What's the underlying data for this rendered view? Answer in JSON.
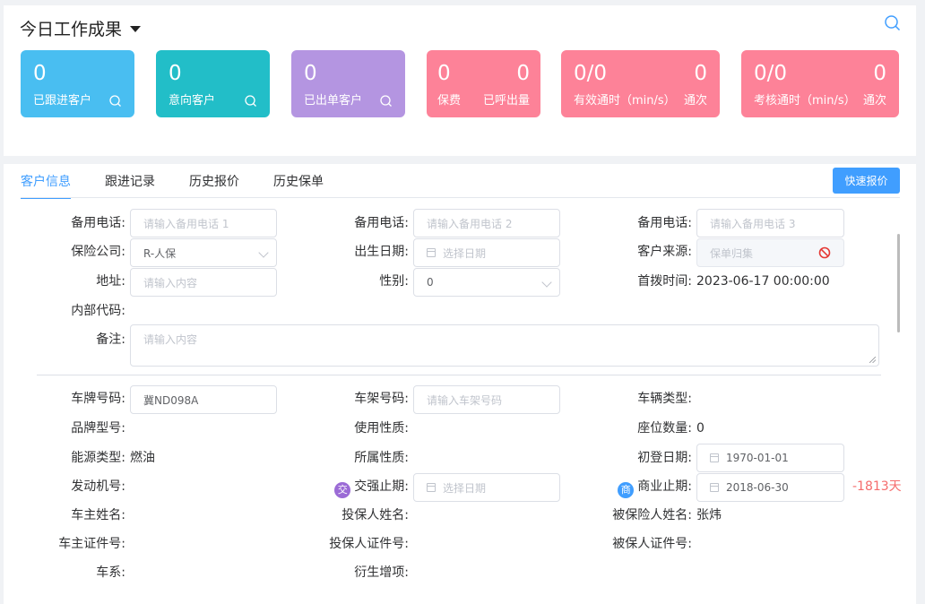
{
  "header": {
    "title": "今日工作成果"
  },
  "colors": {
    "blue": "#49bef1",
    "teal": "#22bec8",
    "purple": "#b495e1",
    "pink": "#fd8298",
    "primary": "#409eff",
    "danger": "#f56c6c"
  },
  "cards": {
    "followed": {
      "value": "0",
      "label": "已跟进客户"
    },
    "intent": {
      "value": "0",
      "label": "意向客户"
    },
    "issued": {
      "value": "0",
      "label": "已出单客户"
    },
    "premium": {
      "value": "0",
      "label": "保费",
      "value2": "0",
      "label2": "已呼出量"
    },
    "effective": {
      "value": "0/0",
      "label": "有效通时（min/s）",
      "value2": "0",
      "label2": "通次"
    },
    "assess": {
      "value": "0/0",
      "label": "考核通时（min/s）",
      "value2": "0",
      "label2": "通次"
    }
  },
  "tabs": [
    "客户信息",
    "跟进记录",
    "历史报价",
    "历史保单"
  ],
  "quick_quote_label": "快速报价",
  "form": {
    "backup_phone_label": "备用电话:",
    "backup_phone1_placeholder": "请输入备用电话 1",
    "backup_phone2_placeholder": "请输入备用电话 2",
    "backup_phone3_placeholder": "请输入备用电话 3",
    "insurer_label": "保险公司:",
    "insurer_value": "R-人保",
    "birth_label": "出生日期:",
    "birth_placeholder": "选择日期",
    "source_label": "客户来源:",
    "source_value": "保单归集",
    "address_label": "地址:",
    "address_placeholder": "请输入内容",
    "gender_label": "性别:",
    "gender_value": "0",
    "first_dial_label": "首拨时间:",
    "first_dial_value": "2023-06-17 00:00:00",
    "internal_code_label": "内部代码:",
    "remark_label": "备注:",
    "remark_placeholder": "请输入内容"
  },
  "vehicle": {
    "plate_label": "车牌号码:",
    "plate_value": "冀ND098A",
    "vin_label": "车架号码:",
    "vin_placeholder": "请输入车架号码",
    "vehicle_type_label": "车辆类型:",
    "brand_label": "品牌型号:",
    "usage_label": "使用性质:",
    "seats_label": "座位数量:",
    "seats_value": "0",
    "energy_label": "能源类型:",
    "energy_value": "燃油",
    "ownership_label": "所属性质:",
    "first_reg_label": "初登日期:",
    "first_reg_value": "1970-01-01",
    "engine_label": "发动机号:",
    "compulsory_badge": "交",
    "compulsory_label": "交强止期:",
    "compulsory_placeholder": "选择日期",
    "commercial_badge": "商",
    "commercial_label": "商业止期:",
    "commercial_value": "2018-06-30",
    "commercial_days": "-1813天",
    "owner_name_label": "车主姓名:",
    "policyholder_name_label": "投保人姓名:",
    "insured_name_label": "被保险人姓名:",
    "insured_name_value": "张炜",
    "owner_id_label": "车主证件号:",
    "policyholder_id_label": "投保人证件号:",
    "insured_id_label": "被保人证件号:",
    "series_label": "车系:",
    "derived_label": "衍生增项:"
  }
}
